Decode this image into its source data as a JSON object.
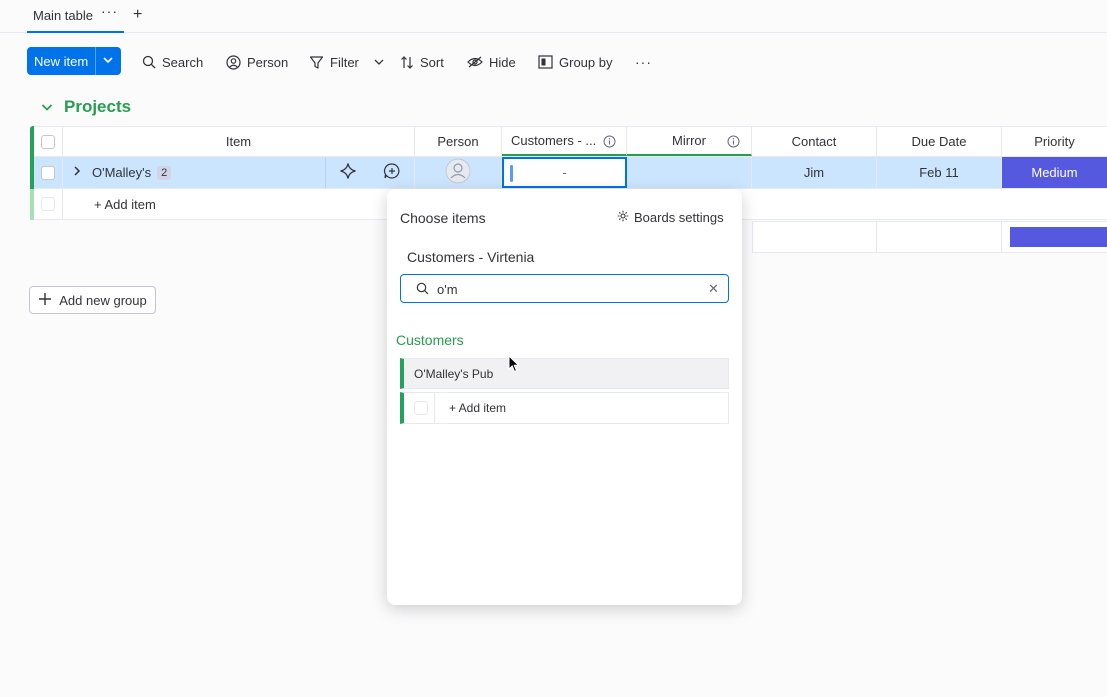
{
  "tabs": {
    "active_label": "Main table",
    "more": "···",
    "add": "+"
  },
  "toolbar": {
    "new_item": "New item",
    "search": "Search",
    "person": "Person",
    "filter": "Filter",
    "sort": "Sort",
    "hide": "Hide",
    "group_by": "Group by",
    "more": "···"
  },
  "group": {
    "title": "Projects",
    "color": "#279d4f"
  },
  "table": {
    "columns": {
      "item": "Item",
      "person": "Person",
      "customers": "Customers - ...",
      "mirror": "Mirror",
      "contact": "Contact",
      "due_date": "Due Date",
      "priority": "Priority"
    },
    "row": {
      "item": "O'Malley's",
      "subitems_count": "2",
      "customers": "-",
      "contact": "Jim",
      "due_date": "Feb 11",
      "priority": "Medium",
      "priority_color": "#5559df"
    },
    "add_item": "+ Add item"
  },
  "add_group": "Add new group",
  "popup": {
    "title": "Choose items",
    "settings": "Boards settings",
    "board_name": "Customers - Virtenia",
    "search_value": "o'm",
    "group_name": "Customers",
    "results": [
      "O'Malley's Pub"
    ],
    "add_item": "+ Add item"
  },
  "colors": {
    "accent": "#0073ea",
    "group_green": "#25a15b",
    "selected_row": "#cce5ff"
  }
}
